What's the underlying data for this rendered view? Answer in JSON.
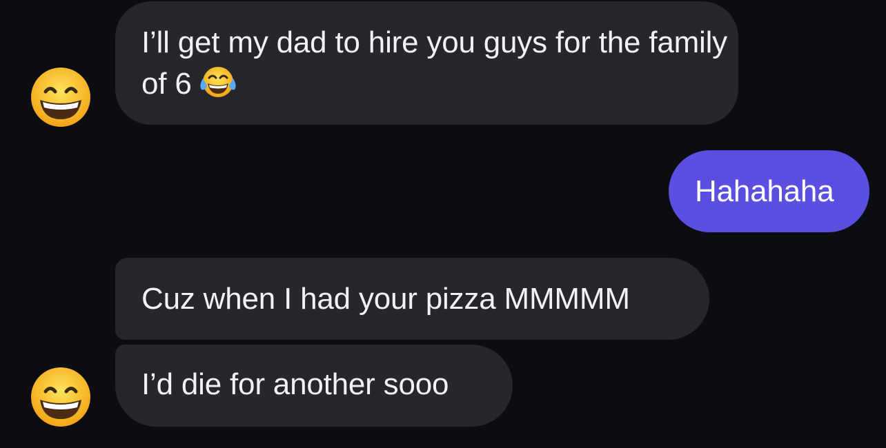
{
  "thread": {
    "messages": [
      {
        "direction": "incoming",
        "text": "I’ll get my dad to hire you guys for the family of 6",
        "emoji": "face-with-tears-of-joy-icon"
      },
      {
        "direction": "outgoing",
        "text": "Hahahaha"
      },
      {
        "direction": "incoming",
        "text": "Cuz when I had your pizza MMMMM"
      },
      {
        "direction": "incoming",
        "text": "I’d die for another sooo"
      }
    ],
    "avatars": [
      {
        "icon": "grinning-face-avatar-icon"
      },
      {
        "icon": "grinning-face-avatar-icon"
      }
    ]
  },
  "colors": {
    "background": "#0b0d12",
    "incoming_bubble": "#25272c",
    "outgoing_bubble": "#5a4fe0",
    "text": "#f2f2f4"
  }
}
